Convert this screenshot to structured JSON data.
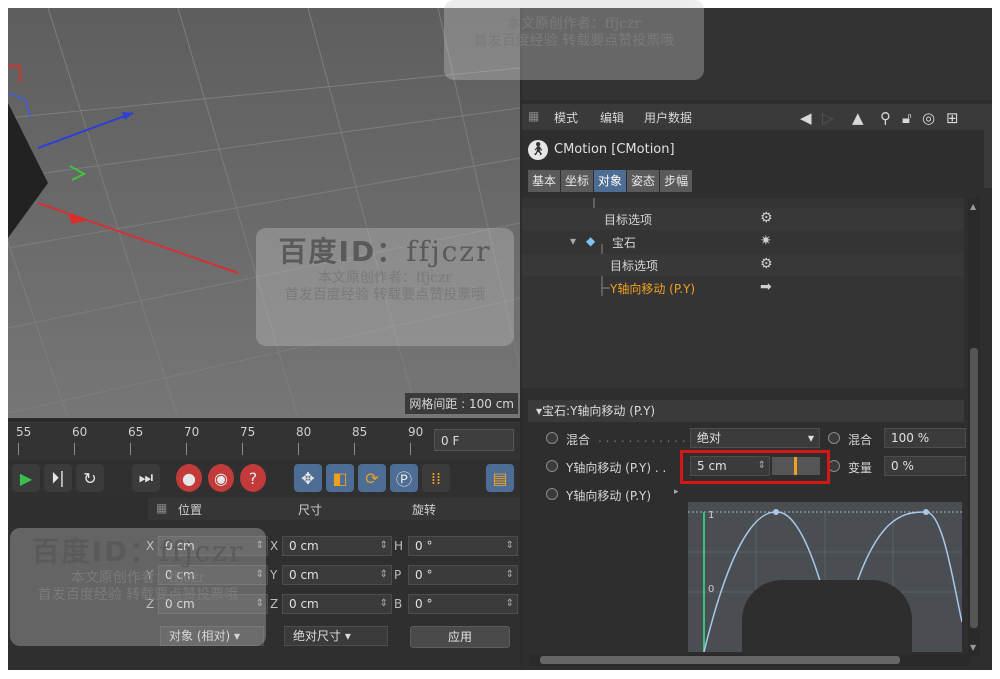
{
  "viewport": {
    "grid_spacing_label": "网格间距 : 100 cm"
  },
  "timeline": {
    "ticks": [
      "55",
      "60",
      "65",
      "70",
      "75",
      "80",
      "85",
      "90"
    ],
    "current_frame": "0 F"
  },
  "coordinates": {
    "headers": {
      "position": "位置",
      "size": "尺寸",
      "rotation": "旋转"
    },
    "rows": [
      {
        "pos_axis": "X",
        "pos_value": "0 cm",
        "size_axis": "X",
        "size_value": "0 cm",
        "rot_axis": "H",
        "rot_value": "0 °"
      },
      {
        "pos_axis": "Y",
        "pos_value": "0 cm",
        "size_axis": "Y",
        "size_value": "0 cm",
        "rot_axis": "P",
        "rot_value": "0 °"
      },
      {
        "pos_axis": "Z",
        "pos_value": "0 cm",
        "size_axis": "Z",
        "size_value": "0 cm",
        "rot_axis": "B",
        "rot_value": "0 °"
      }
    ],
    "mode_dropdown": "对象 (相对)",
    "size_dropdown": "绝对尺寸",
    "apply_button": "应用"
  },
  "attributes": {
    "menu": [
      "模式",
      "编辑",
      "用户数据"
    ],
    "title": "CMotion [CMotion]",
    "tabs": [
      "基本",
      "坐标",
      "对象",
      "姿态",
      "步幅"
    ],
    "active_tab": "对象",
    "tree": [
      {
        "label": "目标选项",
        "icon": "gear-icon"
      },
      {
        "label": "宝石",
        "icon": "sparkle-icon"
      },
      {
        "label": "目标选项",
        "icon": "gear-icon"
      },
      {
        "label": "Y轴向移动 (P.Y)",
        "icon": "arrow-icon",
        "highlight": "#f0a020"
      }
    ],
    "section_title": "▾宝石:Y轴向移动 (P.Y)",
    "params": {
      "mix_label": "混合",
      "mix_mode": "绝对",
      "mix_right_label": "混合",
      "mix_right_value": "100 %",
      "ymove_label": "Y轴向移动 (P.Y) . .",
      "ymove_value": "5 cm",
      "variation_label": "变量",
      "variation_value": "0 %",
      "curve_label": "Y轴向移动 (P.Y)",
      "curve_top": "1",
      "curve_mid": "0"
    }
  },
  "watermark": {
    "big": "百度ID：",
    "handle": "ffjczr",
    "line1": "本文原创作者：ffjczr",
    "line2": "首发百度经验 转载要点赞投票哦"
  },
  "colors": {
    "accent_tab": "#4d6d95",
    "highlight_text": "#f0a020",
    "annotation_red": "#d41818",
    "play_green": "#3bbf4a"
  }
}
